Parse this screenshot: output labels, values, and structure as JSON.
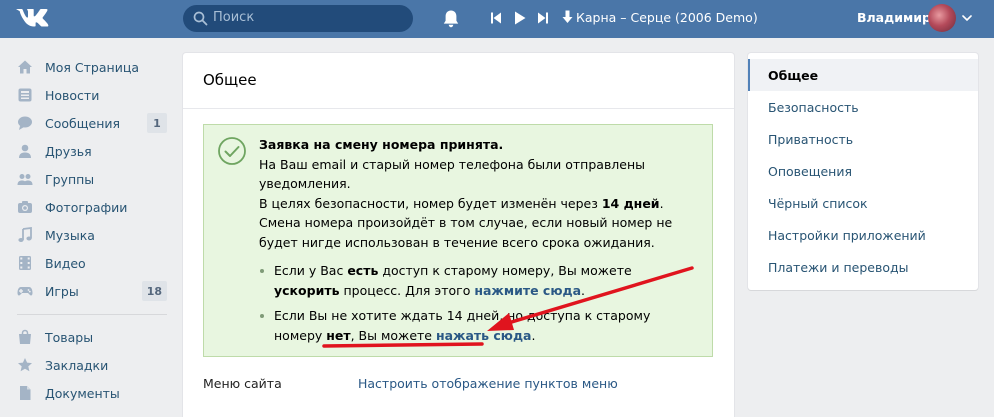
{
  "header": {
    "search_placeholder": "Поиск",
    "track": "Карна – Серце (2006 Demo)",
    "user_name": "Владимир"
  },
  "left_menu": [
    {
      "label": "Моя Страница",
      "icon": "home-icon"
    },
    {
      "label": "Новости",
      "icon": "news-icon"
    },
    {
      "label": "Сообщения",
      "icon": "messages-icon",
      "count": "1"
    },
    {
      "label": "Друзья",
      "icon": "friends-icon"
    },
    {
      "label": "Группы",
      "icon": "groups-icon"
    },
    {
      "label": "Фотографии",
      "icon": "camera-icon"
    },
    {
      "label": "Музыка",
      "icon": "music-icon"
    },
    {
      "label": "Видео",
      "icon": "video-icon"
    },
    {
      "label": "Игры",
      "icon": "games-icon",
      "count": "18"
    },
    {
      "label": "Товары",
      "icon": "shop-icon"
    },
    {
      "label": "Закладки",
      "icon": "star-icon"
    },
    {
      "label": "Документы",
      "icon": "document-icon"
    }
  ],
  "main": {
    "title": "Общее",
    "notice": {
      "heading": "Заявка на смену номера принята.",
      "line1": "На Ваш email и старый номер телефона были отправлены уведомления.",
      "line2a": "В целях безопасности, номер будет изменён через ",
      "line2b": "14 дней",
      "line2c": ".",
      "line3": "Смена номера произойдёт в том случае, если новый номер не будет нигде использован в течение всего срока ожидания.",
      "bullet1": {
        "t1": "Если у Вас ",
        "t2": "есть",
        "t3": " доступ к старому номеру, Вы можете ",
        "t4": "ускорить",
        "t5": " процесс. Для этого ",
        "link": "нажмите сюда",
        "t6": "."
      },
      "bullet2": {
        "t1": "Если Вы не хотите ждать 14 дней, но доступа к старому номеру ",
        "t2": "нет",
        "t3": ", Вы можете ",
        "link": "нажать сюда",
        "t4": "."
      }
    },
    "row_label": "Меню сайта",
    "row_value": "Настроить отображение пунктов меню"
  },
  "right_menu": [
    {
      "label": "Общее",
      "active": true
    },
    {
      "label": "Безопасность"
    },
    {
      "label": "Приватность"
    },
    {
      "label": "Оповещения"
    },
    {
      "label": "Чёрный список"
    },
    {
      "label": "Настройки приложений"
    },
    {
      "label": "Платежи и переводы"
    }
  ],
  "colors": {
    "header_bg": "#4a76a8",
    "link": "#2a5885",
    "notice_bg": "#e8f6e0",
    "arrow": "#e0141e"
  }
}
